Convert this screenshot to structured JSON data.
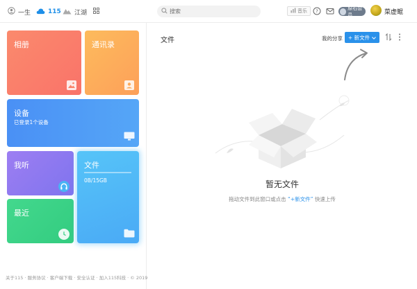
{
  "topnav": {
    "item1": "一生",
    "item2": "115",
    "item3": "江湖"
  },
  "search": {
    "placeholder": "搜索"
  },
  "header": {
    "music_label": "音乐",
    "vip_label": "原石会员",
    "username": "菜虚鲲"
  },
  "sidebar": {
    "tiles": [
      {
        "label": "相册",
        "color": "#fa7d6a"
      },
      {
        "label": "通讯录",
        "color": "#fdae5a"
      },
      {
        "label": "设备",
        "sub": "已登录1个设备",
        "color": "#4b95f5"
      },
      {
        "label": "我听",
        "color": "#8e78f0"
      },
      {
        "label": "文件",
        "sub": "0B/15GB",
        "color": "#4fb8f7"
      },
      {
        "label": "最近",
        "color": "#3ed38a"
      }
    ],
    "footer": "关于115 · 服务协议 · 客户端下载 · 安全认证 · 加入115科技 · © 2019"
  },
  "main": {
    "title": "文件",
    "my_share": "我的分享",
    "new_file_label": "+ 新文件",
    "empty_title": "暂无文件",
    "empty_hint_pre": "拖动文件到此窗口或点击",
    "empty_hint_link": "“+新文件”",
    "empty_hint_post": "快速上传"
  },
  "icons": [
    "user-icon",
    "cloud-icon",
    "mountain-icon",
    "grid-icon",
    "search-icon",
    "music-icon",
    "help-icon",
    "mail-icon",
    "image-icon",
    "contact-icon",
    "monitor-icon",
    "headphones-icon",
    "clock-icon",
    "folder-icon",
    "sort-icon",
    "more-icon",
    "chevron-down-icon"
  ]
}
